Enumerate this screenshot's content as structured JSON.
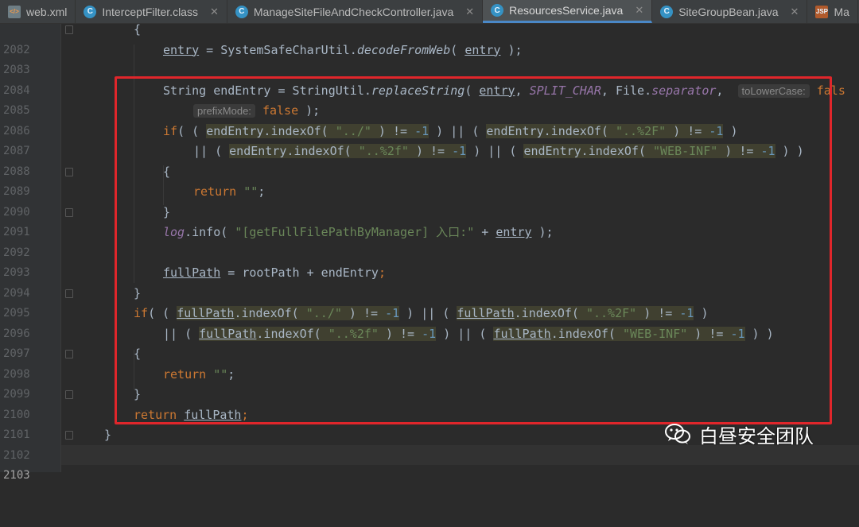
{
  "tabs": [
    {
      "label": "web.xml",
      "icon": "xml-file-icon",
      "active": false
    },
    {
      "label": "InterceptFilter.class",
      "icon": "class-file-icon",
      "active": false
    },
    {
      "label": "ManageSiteFileAndCheckController.java",
      "icon": "class-file-icon",
      "active": false
    },
    {
      "label": "ResourcesService.java",
      "icon": "class-file-icon",
      "active": true
    },
    {
      "label": "SiteGroupBean.java",
      "icon": "class-file-icon",
      "active": false
    },
    {
      "label": "Ma",
      "icon": "jsp-file-icon",
      "active": false
    }
  ],
  "lines": [
    {
      "n": "2082",
      "code": "{"
    },
    {
      "n": "2083",
      "code": "entry = SystemSafeCharUtil.decodeFromWeb( entry );"
    },
    {
      "n": "2084",
      "code": ""
    },
    {
      "n": "2085",
      "code": "String endEntry = StringUtil.replaceString( entry, SPLIT_CHAR, File.separator,"
    },
    {
      "n": "2086",
      "code": "false );"
    },
    {
      "n": "2087",
      "code": "if( ( endEntry.indexOf( \"../\" ) != -1 ) || ( endEntry.indexOf( \"..%2F\" ) != -1 )"
    },
    {
      "n": "2088",
      "code": "|| ( endEntry.indexOf( \"..%2f\" ) != -1 ) || ( endEntry.indexOf( \"WEB-INF\" ) != -1 ) )"
    },
    {
      "n": "2089",
      "code": "{"
    },
    {
      "n": "2090",
      "code": "return \"\";"
    },
    {
      "n": "2091",
      "code": "}"
    },
    {
      "n": "2092",
      "code": "log.info( \"[getFullFilePathByManager] 入口:\" + entry );"
    },
    {
      "n": "2093",
      "code": ""
    },
    {
      "n": "2094",
      "code": "fullPath = rootPath + endEntry;"
    },
    {
      "n": "2095",
      "code": "}"
    },
    {
      "n": "2096",
      "code": "if( ( fullPath.indexOf( \"../\" ) != -1 ) || ( fullPath.indexOf( \"..%2F\" ) != -1 )"
    },
    {
      "n": "2097",
      "code": "|| ( fullPath.indexOf( \"..%2f\" ) != -1 ) || ( fullPath.indexOf( \"WEB-INF\" ) != -1 ) )"
    },
    {
      "n": "2098",
      "code": "{"
    },
    {
      "n": "2099",
      "code": "return \"\";"
    },
    {
      "n": "2100",
      "code": "}"
    },
    {
      "n": "2101",
      "code": "return fullPath;"
    },
    {
      "n": "2102",
      "code": "}"
    },
    {
      "n": "2103",
      "code": ""
    }
  ],
  "hints": {
    "toLowerCase": "toLowerCase:",
    "toLowerCase_value": "fals",
    "prefixMode": "prefixMode:"
  },
  "watermark": {
    "text": "白昼安全团队",
    "icon": "wechat-icon"
  },
  "colors": {
    "highlight_box": "#e0262b",
    "keyword": "#cc7832",
    "string": "#6a8759",
    "number": "#6897bb",
    "field": "#9876aa"
  }
}
